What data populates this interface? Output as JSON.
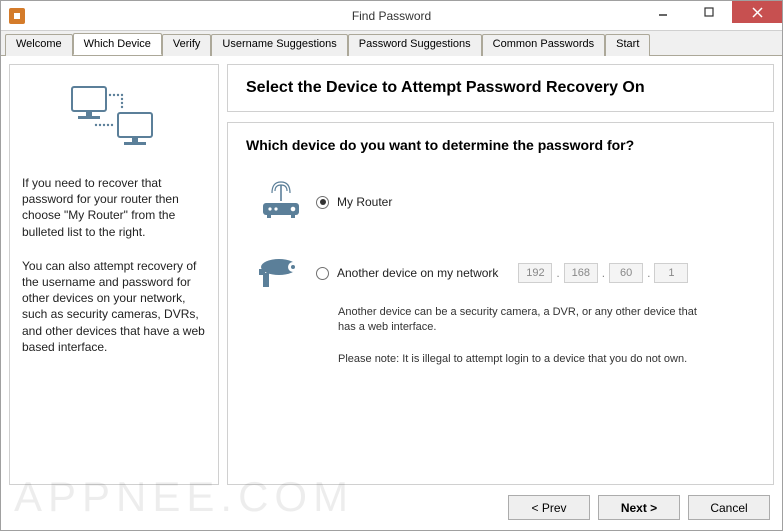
{
  "window": {
    "title": "Find Password"
  },
  "tabs": [
    {
      "label": "Welcome"
    },
    {
      "label": "Which Device"
    },
    {
      "label": "Verify"
    },
    {
      "label": "Username Suggestions"
    },
    {
      "label": "Password Suggestions"
    },
    {
      "label": "Common Passwords"
    },
    {
      "label": "Start"
    }
  ],
  "active_tab": "Which Device",
  "left": {
    "para1": "If you need to recover that password for your router then choose \"My Router\" from the bulleted list to the right.",
    "para2": "You can also attempt recovery of the username and password for other devices on your network, such as security cameras, DVRs, and other devices that have a web based interface."
  },
  "main": {
    "heading": "Select the Device to Attempt Password Recovery On",
    "question": "Which device do you want to determine the password for?",
    "option1": "My Router",
    "option2": "Another device on my network",
    "ip": {
      "a": "192",
      "b": "168",
      "c": "60",
      "d": "1"
    },
    "note1": "Another device can be a security camera, a DVR, or any other device that has a web interface.",
    "note2": "Please note: It is illegal to attempt login to a device that you do not own."
  },
  "buttons": {
    "prev": "< Prev",
    "next": "Next >",
    "cancel": "Cancel"
  },
  "watermark": "APPNEE.COM"
}
